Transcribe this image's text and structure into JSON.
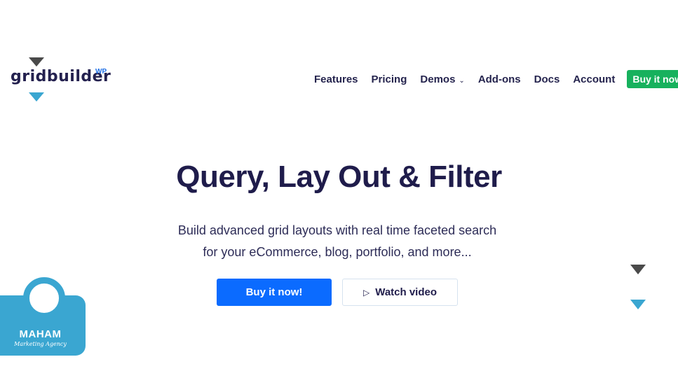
{
  "brand": {
    "name": "gridbuilder",
    "suffix": "WP"
  },
  "nav": {
    "items": [
      {
        "label": "Features"
      },
      {
        "label": "Pricing"
      },
      {
        "label": "Demos",
        "dropdown": true
      },
      {
        "label": "Add-ons"
      },
      {
        "label": "Docs"
      },
      {
        "label": "Account"
      }
    ],
    "buy_label": "Buy it now",
    "chevron": "⌄"
  },
  "hero": {
    "title": "Query, Lay Out & Filter",
    "subtitle_line1": "Build advanced grid layouts with real time faceted search",
    "subtitle_line2": "for your eCommerce, blog, portfolio, and more...",
    "primary_cta": "Buy it now!",
    "secondary_cta": "Watch video",
    "play_icon": "▷"
  },
  "watermark": {
    "name": "MAHAM",
    "tagline": "Marketing Agency"
  },
  "colors": {
    "accent_blue": "#0b6bff",
    "accent_green": "#17b15d",
    "text_dark": "#1f1c4b",
    "triangle_gray": "#4a4a4a",
    "triangle_blue": "#3aa6d1"
  }
}
